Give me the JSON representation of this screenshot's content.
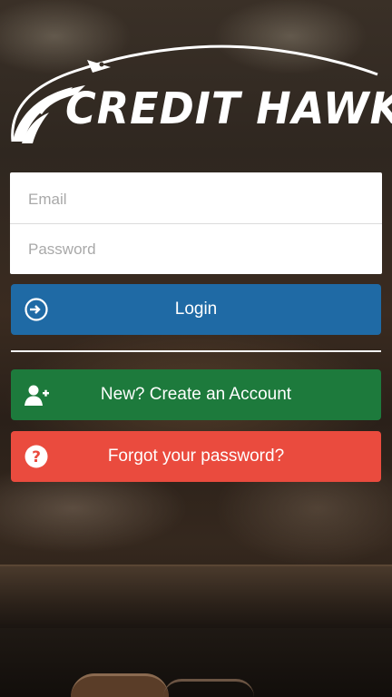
{
  "brand": {
    "name": "CREDIT HAWK"
  },
  "form": {
    "email_placeholder": "Email",
    "password_placeholder": "Password"
  },
  "buttons": {
    "login_label": "Login",
    "create_account_label": "New? Create an Account",
    "forgot_password_label": "Forgot your password?"
  },
  "colors": {
    "login": "#1f6aa5",
    "create_account": "#1d7a3c",
    "forgot_password": "#ea4b3e"
  },
  "icons": {
    "login": "sign-in-icon",
    "create_account": "add-user-icon",
    "forgot_password": "question-circle-icon"
  }
}
